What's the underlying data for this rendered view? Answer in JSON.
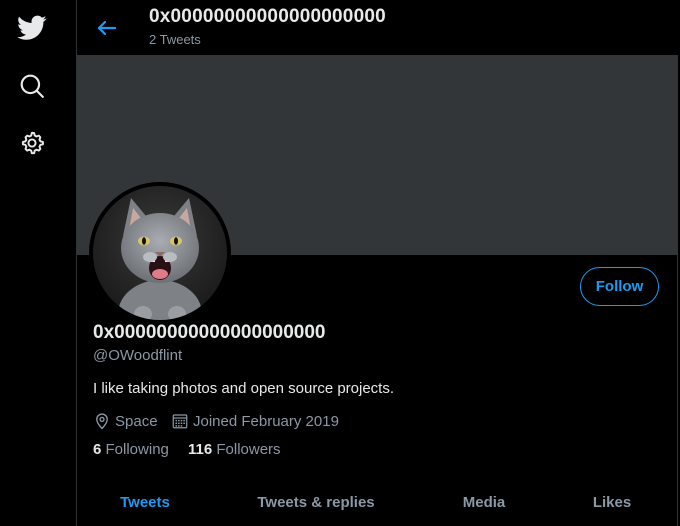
{
  "nav": {
    "icons": [
      "twitter-bird-icon",
      "search-icon",
      "gear-icon"
    ]
  },
  "header": {
    "title": "0x00000000000000000000",
    "tweet_count": "2 Tweets"
  },
  "profile": {
    "name": "0x00000000000000000000",
    "handle": "@OWoodflint",
    "bio": "I like taking photos and open source projects.",
    "location": "Space",
    "joined": "Joined February 2019",
    "following_count": "6",
    "following_label": "Following",
    "followers_count": "116",
    "followers_label": "Followers",
    "follow_button": "Follow"
  },
  "tabs": [
    {
      "label": "Tweets",
      "active": true
    },
    {
      "label": "Tweets & replies",
      "active": false
    },
    {
      "label": "Media",
      "active": false
    },
    {
      "label": "Likes",
      "active": false
    }
  ],
  "colors": {
    "accent": "#1d9bf0",
    "background": "#000000",
    "banner": "#333639",
    "muted_text": "#8b98a5"
  }
}
